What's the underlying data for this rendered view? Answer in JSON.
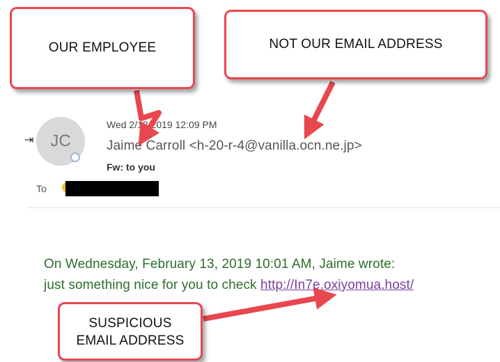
{
  "callouts": {
    "employee": "OUR EMPLOYEE",
    "not_ours": "NOT OUR EMAIL ADDRESS",
    "suspicious_line1": "SUSPICIOUS",
    "suspicious_line2": "EMAIL ADDRESS"
  },
  "email": {
    "avatar_initials": "JC",
    "datetime": "Wed 2/13/2019 12:09 PM",
    "sender_name": "Jaime Carroll",
    "sender_address": "<h-20-r-4@vanilla.ocn.ne.jp>",
    "subject": "Fw: to you",
    "to_label": "To",
    "body_line1": "On Wednesday, February 13, 2019 10:01 AM, Jaime wrote:",
    "body_line2_text": "just something nice for you to check",
    "body_link": "http://In7e.oxiyomua.host/"
  },
  "colors": {
    "callout_border": "#e8474f",
    "arrow": "#e8474f",
    "body_text": "#2c6e2c",
    "link": "#7a3e9d"
  },
  "icons": [
    "expand-icon",
    "avatar",
    "presence-icon"
  ]
}
